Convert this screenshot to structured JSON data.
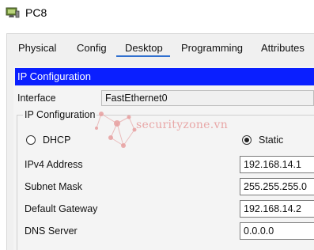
{
  "window": {
    "title": "PC8",
    "icon": "pc-icon"
  },
  "tabs": [
    {
      "label": "Physical"
    },
    {
      "label": "Config"
    },
    {
      "label": "Desktop",
      "active": true
    },
    {
      "label": "Programming"
    },
    {
      "label": "Attributes"
    }
  ],
  "panel": {
    "header": "IP Configuration",
    "interface_label": "Interface",
    "interface_value": "FastEthernet0",
    "group_title": "IP Configuration",
    "dhcp_label": "DHCP",
    "static_label": "Static",
    "selected_mode": "Static",
    "ipv4_label": "IPv4 Address",
    "ipv4_value": "192.168.14.1",
    "subnet_label": "Subnet Mask",
    "subnet_value": "255.255.255.0",
    "gateway_label": "Default Gateway",
    "gateway_value": "192.168.14.2",
    "dns_label": "DNS Server",
    "dns_value": "0.0.0.0"
  },
  "watermark": {
    "text": "securityzone.vn"
  },
  "colors": {
    "header_bg": "#0a1fff",
    "tab_underline": "#2f6fcf",
    "watermark": "#e79a9a"
  }
}
